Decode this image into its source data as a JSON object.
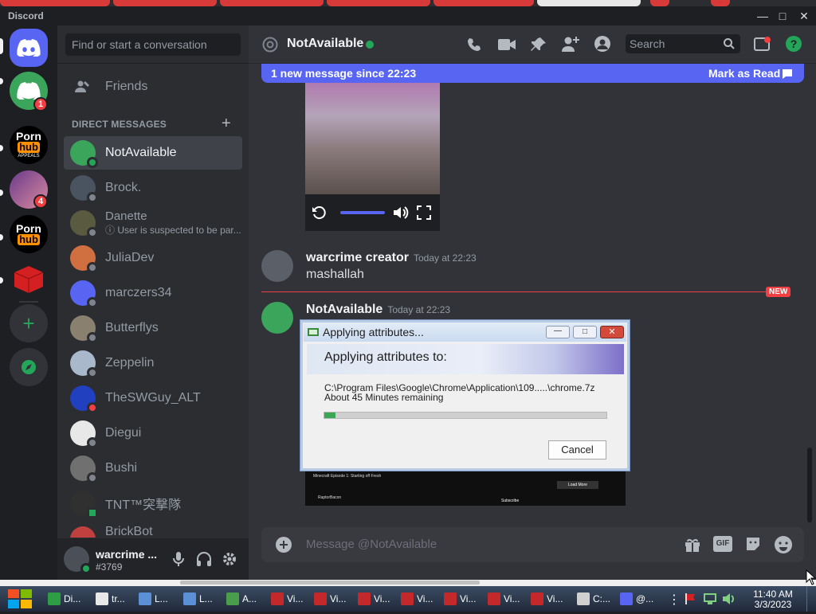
{
  "app": {
    "title": "Discord"
  },
  "rail": {
    "servers": [
      {
        "name": "Direct Messages"
      },
      {
        "name": "Server 1",
        "badge": "1"
      },
      {
        "name": "Pornhub Appeals",
        "line1": "Porn",
        "line2": "hub",
        "line3": "APPEALS"
      },
      {
        "name": "Server 4",
        "badge": "4"
      },
      {
        "name": "Pornhub",
        "line1": "Porn",
        "line2": "hub"
      },
      {
        "name": "Roblox"
      },
      {
        "name": "Add a Server"
      },
      {
        "name": "Explore Discoverable Servers"
      }
    ]
  },
  "sidebar": {
    "search_label": "Find or start a conversation",
    "friends_label": "Friends",
    "dm_header": "DIRECT MESSAGES",
    "dms": [
      {
        "name": "NotAvailable",
        "status_color": "#23a55a"
      },
      {
        "name": "Brock.",
        "status_color": "#80848e"
      },
      {
        "name": "Danette",
        "sub": "ⓘ User is suspected to be par...",
        "status_color": "#80848e"
      },
      {
        "name": "JuliaDev",
        "status_color": "#80848e"
      },
      {
        "name": "marczers34",
        "status_color": "#80848e"
      },
      {
        "name": "Butterflys",
        "status_color": "#80848e"
      },
      {
        "name": "Zeppelin",
        "status_color": "#80848e"
      },
      {
        "name": "TheSWGuy_ALT",
        "status_color": "#f23f43"
      },
      {
        "name": "Diegui",
        "status_color": "#80848e"
      },
      {
        "name": "Bushi",
        "status_color": "#80848e"
      },
      {
        "name": "TNT™突撃隊",
        "status_color": "#23a55a"
      },
      {
        "name": "BrickBot",
        "status_color": "#80848e"
      }
    ]
  },
  "user": {
    "name": "warcrime ...",
    "tag": "#3769"
  },
  "chat": {
    "channel_name": "NotAvailable",
    "search_placeholder": "Search",
    "new_banner": "1 new message since 22:23",
    "mark_read": "Mark as Read",
    "messages": [
      {
        "author": "warcrime creator",
        "time": "Today at 22:23",
        "text": "mashallah"
      },
      {
        "author": "NotAvailable",
        "time": "Today at 22:23"
      }
    ],
    "new_divider": "NEW",
    "embed": {
      "video_title": "Minecraft Episode 1: Starting off Fresh",
      "channel": "RaptorBacon",
      "load_more": "Load More",
      "subscribe": "Subscribe"
    },
    "composer_placeholder": "Message @NotAvailable"
  },
  "dialog": {
    "title": "Applying attributes...",
    "heading": "Applying attributes to:",
    "path": "C:\\Program Files\\Google\\Chrome\\Application\\109.....\\chrome.7z",
    "remaining": "About 45 Minutes remaining",
    "progress": 0.04,
    "cancel": "Cancel"
  },
  "taskbar": {
    "items": [
      {
        "label": "Di...",
        "color": "#2e9e44"
      },
      {
        "label": "tr...",
        "color": "#e8e8e8"
      },
      {
        "label": "L...",
        "color": "#5b8fd6"
      },
      {
        "label": "L...",
        "color": "#5b8fd6"
      },
      {
        "label": "A...",
        "color": "#4a9d4a"
      },
      {
        "label": "Vi...",
        "color": "#c3282b"
      },
      {
        "label": "Vi...",
        "color": "#c3282b"
      },
      {
        "label": "Vi...",
        "color": "#c3282b"
      },
      {
        "label": "Vi...",
        "color": "#c3282b"
      },
      {
        "label": "Vi...",
        "color": "#c3282b"
      },
      {
        "label": "Vi...",
        "color": "#c3282b"
      },
      {
        "label": "Vi...",
        "color": "#c3282b"
      },
      {
        "label": "C:...",
        "color": "#d0d0d0"
      },
      {
        "label": "@...",
        "color": "#5865f2"
      }
    ],
    "time": "11:40 AM",
    "date": "3/3/2023"
  }
}
